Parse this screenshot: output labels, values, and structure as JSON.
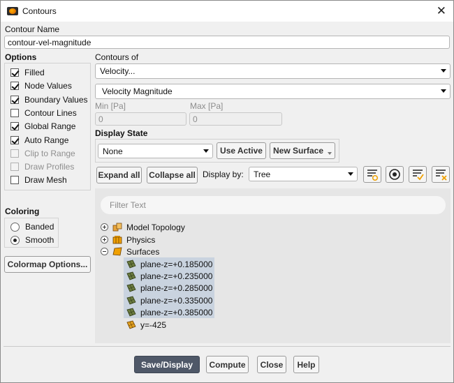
{
  "window": {
    "title": "Contours",
    "close_glyph": "✕"
  },
  "contour_name": {
    "label": "Contour Name",
    "value": "contour-vel-magnitude"
  },
  "options": {
    "heading": "Options",
    "items": [
      {
        "label": "Filled",
        "checked": true,
        "enabled": true
      },
      {
        "label": "Node Values",
        "checked": true,
        "enabled": true
      },
      {
        "label": "Boundary Values",
        "checked": true,
        "enabled": true
      },
      {
        "label": "Contour Lines",
        "checked": false,
        "enabled": true
      },
      {
        "label": "Global Range",
        "checked": true,
        "enabled": true
      },
      {
        "label": "Auto Range",
        "checked": true,
        "enabled": true
      },
      {
        "label": "Clip to Range",
        "checked": false,
        "enabled": false
      },
      {
        "label": "Draw Profiles",
        "checked": false,
        "enabled": false
      },
      {
        "label": "Draw Mesh",
        "checked": false,
        "enabled": true
      }
    ]
  },
  "coloring": {
    "heading": "Coloring",
    "options": [
      {
        "label": "Banded",
        "selected": false
      },
      {
        "label": "Smooth",
        "selected": true
      }
    ],
    "colormap_button": "Colormap Options..."
  },
  "contours_of": {
    "label": "Contours of",
    "category": "Velocity...",
    "quantity": "Velocity Magnitude"
  },
  "range": {
    "min_label": "Min [Pa]",
    "min_value": "0",
    "max_label": "Max [Pa]",
    "max_value": "0"
  },
  "display_state": {
    "heading": "Display State",
    "value": "None",
    "use_active": "Use Active",
    "new_surface": "New Surface"
  },
  "tree_controls": {
    "expand_all": "Expand all",
    "collapse_all": "Collapse all",
    "display_by_label": "Display by:",
    "display_by_value": "Tree"
  },
  "tree": {
    "filter_placeholder": "Filter Text",
    "model_topology": "Model Topology",
    "physics": "Physics",
    "surfaces": "Surfaces",
    "surface_items": [
      {
        "label": "plane-z=+0.185000",
        "selected": true
      },
      {
        "label": "plane-z=+0.235000",
        "selected": true
      },
      {
        "label": "plane-z=+0.285000",
        "selected": true
      },
      {
        "label": "plane-z=+0.335000",
        "selected": true
      },
      {
        "label": "plane-z=+0.385000",
        "selected": true
      },
      {
        "label": "y=-425",
        "selected": false
      }
    ]
  },
  "buttons": {
    "save_display": "Save/Display",
    "compute": "Compute",
    "close": "Close",
    "help": "Help"
  },
  "colors": {
    "primary_button": "#4f5868",
    "selection": "#c9d3df",
    "tree_bg": "#e6e6e6",
    "accent_orange": "#f0a000"
  }
}
